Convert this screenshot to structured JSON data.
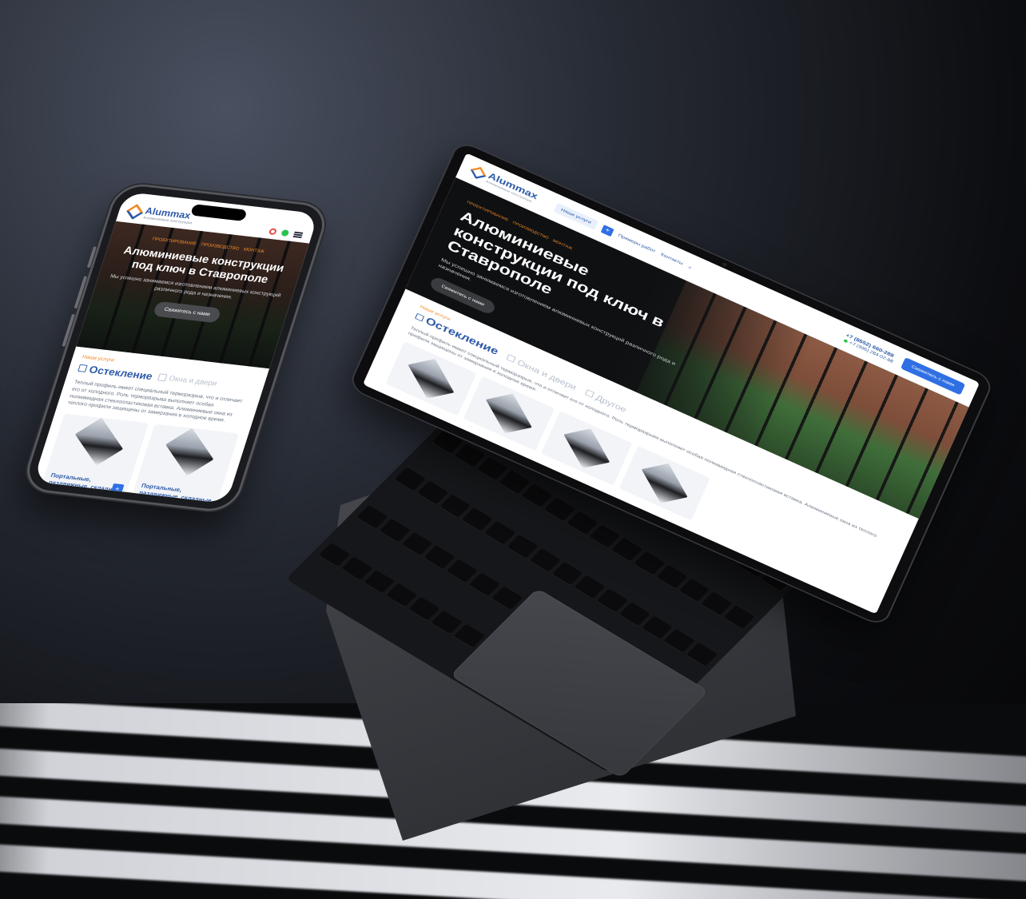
{
  "brand": {
    "name": "Alummax",
    "tagline": "Алюминиевые конструкции"
  },
  "header": {
    "services_button": "Наши услуги",
    "plus_label": "+",
    "nav_links": [
      "Примеры работ",
      "Контакты"
    ],
    "phone_primary": "+7 (8652) 660-288",
    "phone_secondary": "+7 (996) 284-02-88",
    "cta_label": "Свяжитесь с нами"
  },
  "hero": {
    "tags": [
      "ПРОЕКТИРОВАНИЕ",
      "ПРОИЗВОДСТВО",
      "МОНТАЖ"
    ],
    "title": "Алюминиевые конструкции под ключ в Ставрополе",
    "description": "Мы успешно занимаемся изготовлением алюминиевых конструкций различного рода и назначения.",
    "button_label": "Свяжитесь с нами"
  },
  "services": {
    "eyebrow": "Наши услуги",
    "tabs": [
      {
        "label": "Остекление",
        "active": true
      },
      {
        "label": "Окна и двери",
        "active": false
      },
      {
        "label": "Другое",
        "active": false
      }
    ],
    "description": "Теплый профиль имеет специальный терморазрыв, что и отличает его от холодного. Роль терморазрыва выполняет особая полиамидная стеклопластиковая вставка. Алюминиевые окна из теплого профиля защищены от замерзания в холодное время.",
    "card_title": "Портальные, раздвижные, складные",
    "card_plus": "+"
  },
  "colors": {
    "accent_blue": "#2f6fe3",
    "brand_blue": "#2d5aa8",
    "accent_orange": "#f28a26",
    "whatsapp_green": "#2bc24f"
  },
  "icons": [
    "logo-mark-icon",
    "search-icon",
    "whatsapp-icon",
    "phone-icon",
    "menu-icon",
    "glazing-icon",
    "window-door-icon",
    "other-icon",
    "plus-icon"
  ]
}
